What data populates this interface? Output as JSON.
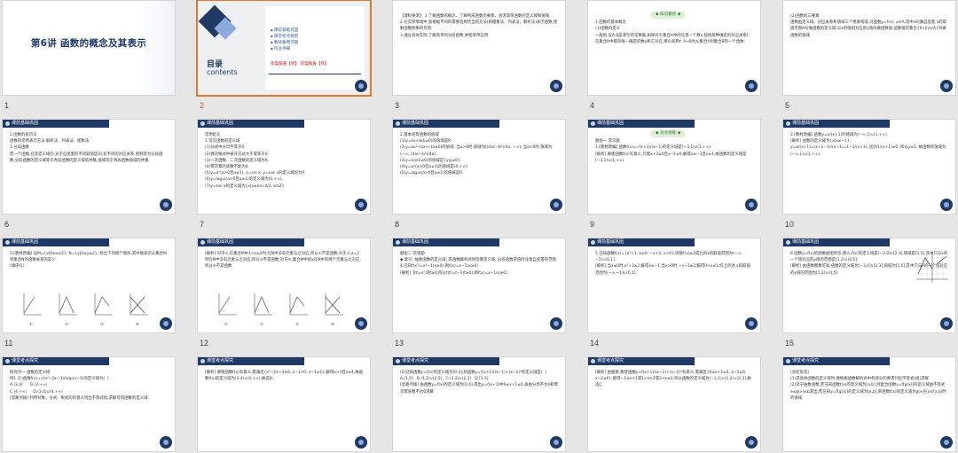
{
  "selected_slide": "2",
  "slides": [
    {
      "num": "1",
      "type": "title",
      "title": "第6讲  函数的概念及其表示"
    },
    {
      "num": "2",
      "type": "toc",
      "mulu": "目录",
      "contents": "contents",
      "items": [
        "课前基础巩固",
        "课堂考点探究",
        "教师备用习题",
        "作业手册"
      ],
      "tags": "答案核查【听】     答案核查【作】"
    },
    {
      "num": "3",
      "type": "text",
      "header": "",
      "text": "【课标要求】 1.了解函数的概念、了解构成函数的要素、会求简单函数的定义域和值域.\n2.在实际情境中,会根据不同的需要选择恰当的方法(如图象法、列表法、解析法)表示函数,理解函数图象的作用.\n3.通过具体实例,了解简单的分段函数,并能简单应用."
    },
    {
      "num": "4",
      "type": "text",
      "header": "",
      "pill": "◆ 知识聚焦 ◆",
      "text": "\n1.函数的基本概念\n(1)函数的定义\n一般地,设A,B是非空的实数集,如果对于集合A中的任意一个数x,按照某种确定的对应关系f,在集合B中都有唯一确定的数y和它对应,那么就称f: A→B为从集合A到集合B的一个函数."
    },
    {
      "num": "5",
      "type": "text",
      "header": "",
      "text": "(2)函数的三要素\n函数由定义域、对应关系和值域三个要素构成,对函数y=f(x), x∈A,其中x叫做自变量,x的取值范围A叫做函数的定义域;与x的值相对应的y值叫做函数值,函数值的集合{f(x)|x∈A}叫做函数的值域."
    },
    {
      "num": "6",
      "type": "text",
      "header": "课前基础巩固",
      "text": "2.函数的表示法\n函数的常用表示方法:解析法、列表法、图象法.\n3.分段函数\n若一个函数,在其定义域内,对于自变量的不同取值区间,有不同的对应关系,则称其为分段函数.分段函数的定义域等于各段函数的定义域的并集,值域等于各段函数值域的并集."
    },
    {
      "num": "7",
      "type": "text",
      "header": "课前基础巩固",
      "text": "常用结论\n1.常见函数的定义域\n(1)分式中分母不等于0.\n(2)偶次根式中被开方式大于或等于0.\n(3)一次函数、二次函数的定义域为R.\n(4)零次幂的底数不能为0.\n(5)y=aˣ(a>0且a≠1), y=sin x, y=cos x的定义域均为R.\n(6)y=logₐx(a>0且a≠1)的定义域为(0,+∞).\n(7)y=tan x的定义域为{x|x≠kπ+π/2, k∈Z}."
    },
    {
      "num": "8",
      "type": "text",
      "header": "课前基础巩固",
      "text": "2.基本初等函数的值域\n(1)y=kx+b(k≠0)的值域是R.\n(2)y=ax²+bx+c(a≠0)的值域: 当a>0时,值域为[(4ac−b²)/4a, +∞); 当a<0时,值域为(−∞, (4ac−b²)/4a].\n(3)y=k/x(k≠0)的值域是{y|y≠0}.\n(4)y=aˣ(a>0且a≠1)的值域是(0,+∞).\n(5)y=logₐx(a>0且a≠1)的值域是R."
    },
    {
      "num": "9",
      "type": "text",
      "header": "课前基础巩固",
      "pill": "◆ 对点演练 ◆",
      "text": "\n题组一 常识题\n1.[教材改编] 函数f(x)=√(x+3)/(x−1)的定义域是[−3,1)∪(1,+∞).\n[解析] 要使函数f(x)有意义,只需x+3≥0且x−1≠0,解得x≥−3且x≠1,故函数的定义域是[−3,1)∪(1,+∞)."
    },
    {
      "num": "10",
      "type": "text",
      "header": "课前基础巩固",
      "text": "2.[教材改编] 函数y=x/(x+1)的值域为(−∞,1)∪(1,+∞).\n[解析] 函数的定义域为{x|x≠−1},\ny=x/(x+1)=(x+1−1)/(x+1)=1−1/(x+1), 因为1/(x+1)≠0, 所以y≠1, 故函数的值域为(−∞,1)∪(1,+∞)."
    },
    {
      "num": "11",
      "type": "graphs",
      "header": "课前基础巩固",
      "text": "3.[教材改编] 设M={x|0≤x≤2}, N={y|0≤y≤2}, 给出下列四个图形,其中能表示从集合M到集合N的函数关系的是②.\n(填序号)",
      "labels": [
        "①",
        "②",
        "③",
        "④"
      ]
    },
    {
      "num": "12",
      "type": "graphs",
      "header": "课前基础巩固",
      "text": "[解析] 对于①,在集合M中1<x≤2时,在N中没有元素与之对应,所以①不是函数;对于③,x=2时在N中没有元素与之对应,所以③不是函数;对于④,集合M中的x在N中有两个元素与之对应,所以④不是函数.",
      "labels": [
        "①",
        "②",
        "③",
        "④"
      ]
    },
    {
      "num": "13",
      "type": "text",
      "header": "课前基础巩固",
      "text": "题组二 常错题\n◆ 索引: 抽象函数的定义域; 求函数解析式时忽略定义域; 分段函数求值时注意自变量的范围.\n4.已知f(x²)=x²−1(x≥0),则f(x)=x−1(x≥0).\n[解析] 令t=x²,则t≥0,所以f(t)=t−1(t≥0),即f(x)=x−1(x≥0)."
    },
    {
      "num": "14",
      "type": "text",
      "header": "课前基础巩固",
      "text": "5.已知函数f(x)={x²+1, x≤0; −x+3, x>0},则使f(x)≥2成立的x的取值范围为(−∞,−1]∪(0,1].\n[解析] 当x≤0时,x²+1≥2,解得x≤−1;当x>0时,−x+3≥2,解得0<x≤1.综上所述,x的取值范围为(−∞,−1]∪(0,1]."
    },
    {
      "num": "15",
      "type": "graph-single",
      "header": "课前基础巩固",
      "text": "6.函数y=f(x)的图象如图所示,那么,f(x)的定义域是[−3,0]∪[2,3],值域是[1,5],其中只与x的一个值对应的y值的范围是[1,2)∪(4,5].\n[解析] 由函数图象可知,函数的定义域为[−3,0]∪[2,3],值域为[1,5],其中只与x的一个值对应的y值的范围为[1,2)∪(4,5]."
    },
    {
      "num": "16",
      "type": "text",
      "header": "课堂考点探究",
      "text": "探究点一 函数的定义域\n例1 (1)函数f(x)=√(x²−2x−3)/log₂(x−1)的定义域为(  )\nA.(3,4)      B.(3,+∞)\nC.(4,+∞)     D.(3,4)∪(4,+∞)\n[思路点拨] 利用对数、分式、根式的有意义列出不等式组,求解可得函数的定义域."
    },
    {
      "num": "17",
      "type": "text",
      "header": "课堂考点探究",
      "text": "[解析] 要使函数f(x)有意义,需满足{x²−2x−3≥0, x−1>0, x−1≠1},解得x>3且x≠4,故函数f(x)的定义域为(3,4)∪(4,+∞),故选D."
    },
    {
      "num": "18",
      "type": "text",
      "header": "课堂考点探究",
      "text": "(2)已知函数y=f(x)的定义域为[0,4],则函数y=f(x+1)/(x−1)+(x−2)⁰的定义域是(  )\nA.[1,5]   B.(1,2)∪(2,5)   C.(1,2)∪(2,3]   D.[1,3]\n[思路点拨] 由函数y=f(x)的定义域为[0,4],得出y=f(x+1)中0≤x+1≤4,再由分母不为0和零次幂底数不为0求解."
    },
    {
      "num": "19",
      "type": "text",
      "header": "课堂考点探究",
      "text": "[解析] 由题意,要使函数y=f(x+1)/(x−1)+(x−2)⁰有意义,需满足{0≤x+1≤4, x−1≠0, x−2≠0},解得−1≤x<1或1<x<2或2<x≤3,所以函数的定义域为[−1,1)∪(1,2)∪(2,3],故选C."
    },
    {
      "num": "20",
      "type": "text",
      "header": "课堂考点探究",
      "text": "[总结反思]\n(1)求具体函数的定义域时,要根据函数解析式中各部分的要求列出不等式(组)求解.\n(2)对于抽象函数,若已知函数f(x)的定义域为[a,b],则复合函数y=f[g(x)]的定义域由不等式a≤g(x)≤b求出;若已知y=f[g(x)]的定义域为[a,b],则函数f(x)的定义域为g(x)在x∈[a,b]时的值域."
    }
  ],
  "colors": {
    "header": "#1f3864",
    "accent": "#c00000",
    "select": "#e07a2e"
  }
}
